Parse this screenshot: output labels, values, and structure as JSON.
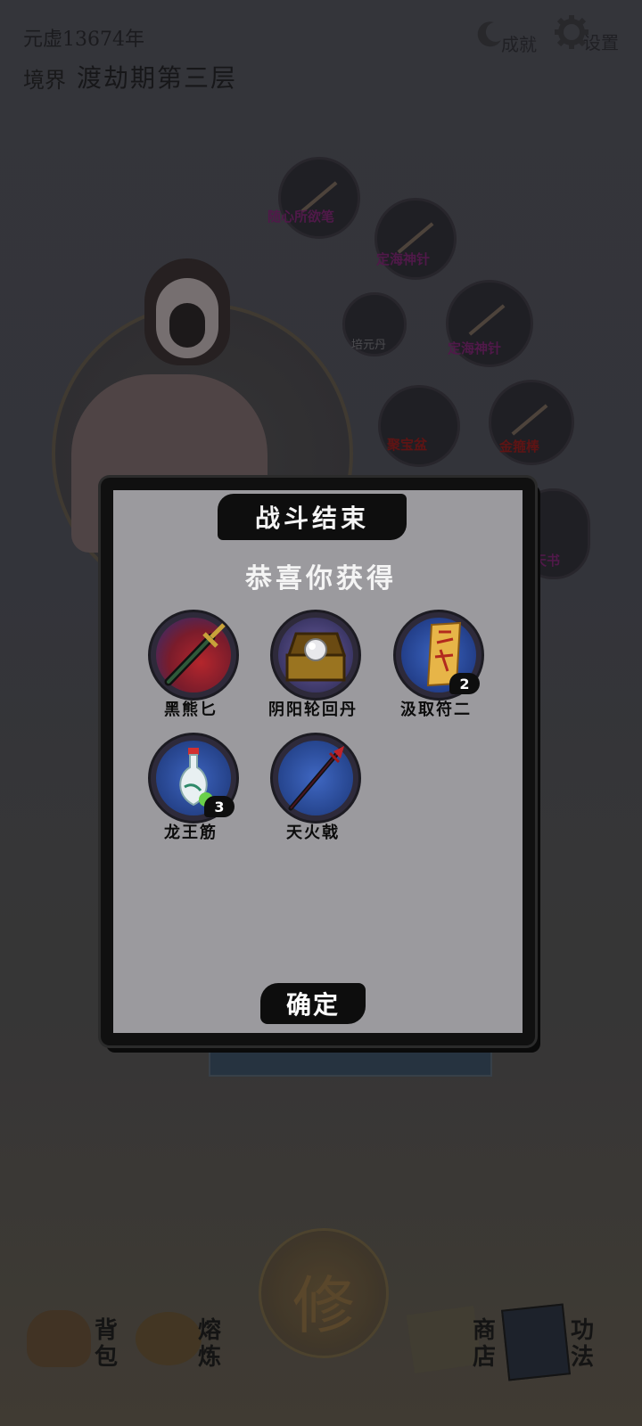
{
  "hud": {
    "era": "元虚13674年",
    "realm_label": "境界",
    "realm_value": "渡劫期第三层",
    "achievements_label": "成就",
    "settings_label": "设置"
  },
  "map_nodes": [
    {
      "label": "随心所欲笔"
    },
    {
      "label": "定海神针"
    },
    {
      "label": "培元丹"
    },
    {
      "label": "定海神针"
    },
    {
      "label": "聚宝盆"
    },
    {
      "label": "金箍棒"
    },
    {
      "label": "天书"
    }
  ],
  "bottom_nav": {
    "bag": "背包",
    "refine": "熔炼",
    "shop": "商店",
    "skills": "功法",
    "cultivate": "修"
  },
  "dialog": {
    "title": "战斗结束",
    "subtitle": "恭喜你获得",
    "confirm": "确定",
    "items": [
      {
        "name": "黑熊匕",
        "icon": "dagger-icon",
        "count": null
      },
      {
        "name": "阴阳轮回丹",
        "icon": "treasure-chest-icon",
        "count": null
      },
      {
        "name": "汲取符二",
        "icon": "talisman-scroll-icon",
        "count": "2"
      },
      {
        "name": "龙王筋",
        "icon": "porcelain-vase-icon",
        "count": "3"
      },
      {
        "name": "天火戟",
        "icon": "halberd-icon",
        "count": null
      }
    ]
  },
  "colors": {
    "dialog_bg": "#9b9a9e",
    "dialog_border": "#101010",
    "accent_red": "#a8232b",
    "accent_blue": "#2f55a8"
  }
}
